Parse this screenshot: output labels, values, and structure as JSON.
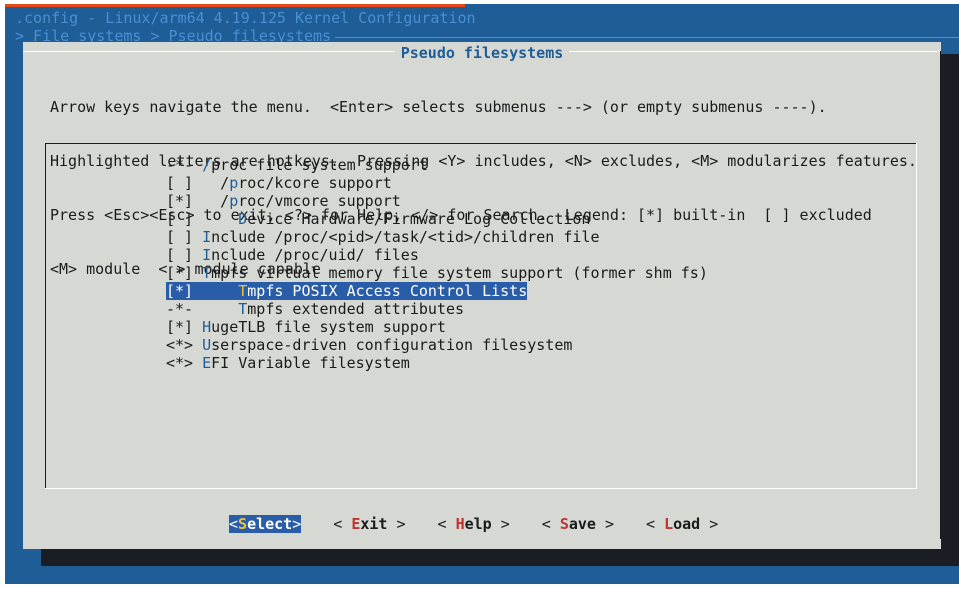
{
  "window": {
    "title": ".config - Linux/arm64 4.19.125 Kernel Configuration",
    "breadcrumb": "> File systems > Pseudo filesystems "
  },
  "dialog": {
    "title": "Pseudo filesystems",
    "help_lines": [
      "Arrow keys navigate the menu.  <Enter> selects submenus ---> (or empty submenus ----).",
      "Highlighted letters are hotkeys.  Pressing <Y> includes, <N> excludes, <M> modularizes features.",
      "Press <Esc><Esc> to exit, <?> for Help, </> for Search.  Legend: [*] built-in  [ ] excluded",
      "<M> module  < > module capable"
    ]
  },
  "menu": {
    "items": [
      {
        "prefix": "-*- ",
        "hotkey": "/",
        "rest": "proc file system support",
        "selected": false
      },
      {
        "prefix": "[ ]   /",
        "hotkey": "p",
        "rest": "roc/kcore support",
        "selected": false
      },
      {
        "prefix": "[*]   /",
        "hotkey": "p",
        "rest": "roc/vmcore support",
        "selected": false
      },
      {
        "prefix": "[ ]     ",
        "hotkey": "D",
        "rest": "evice Hardware/Firmware Log Collection",
        "selected": false
      },
      {
        "prefix": "[ ] ",
        "hotkey": "I",
        "rest": "nclude /proc/<pid>/task/<tid>/children file",
        "selected": false
      },
      {
        "prefix": "[ ] ",
        "hotkey": "I",
        "rest": "nclude /proc/uid/ files",
        "selected": false
      },
      {
        "prefix": "[*] ",
        "hotkey": "T",
        "rest": "mpfs virtual memory file system support (former shm fs)",
        "selected": false
      },
      {
        "prefix": "[*]     ",
        "hotkey": "T",
        "rest": "mpfs POSIX Access Control Lists",
        "selected": true
      },
      {
        "prefix": "-*-     ",
        "hotkey": "T",
        "rest": "mpfs extended attributes",
        "selected": false
      },
      {
        "prefix": "[*] ",
        "hotkey": "H",
        "rest": "ugeTLB file system support",
        "selected": false
      },
      {
        "prefix": "<*> ",
        "hotkey": "U",
        "rest": "serspace-driven configuration filesystem",
        "selected": false
      },
      {
        "prefix": "<*> ",
        "hotkey": "E",
        "rest": "FI Variable filesystem",
        "selected": false
      }
    ]
  },
  "buttons": [
    {
      "open": "<",
      "hotkey": "S",
      "rest": "elect",
      "close": ">",
      "active": true
    },
    {
      "open": "< ",
      "hotkey": "E",
      "rest": "xit",
      "close": " >",
      "active": false
    },
    {
      "open": "< ",
      "hotkey": "H",
      "rest": "elp",
      "close": " >",
      "active": false
    },
    {
      "open": "< ",
      "hotkey": "S",
      "rest": "ave",
      "close": " >",
      "active": false
    },
    {
      "open": "< ",
      "hotkey": "L",
      "rest": "oad",
      "close": " >",
      "active": false
    }
  ],
  "colors": {
    "terminal_bg": "#1f5d96",
    "dialog_bg": "#d6d8d4",
    "selection_bg": "#2a5da8",
    "hotkey_menu": "#1f5d96",
    "hotkey_button": "#c0322e",
    "hotkey_selected": "#f0c23a"
  }
}
